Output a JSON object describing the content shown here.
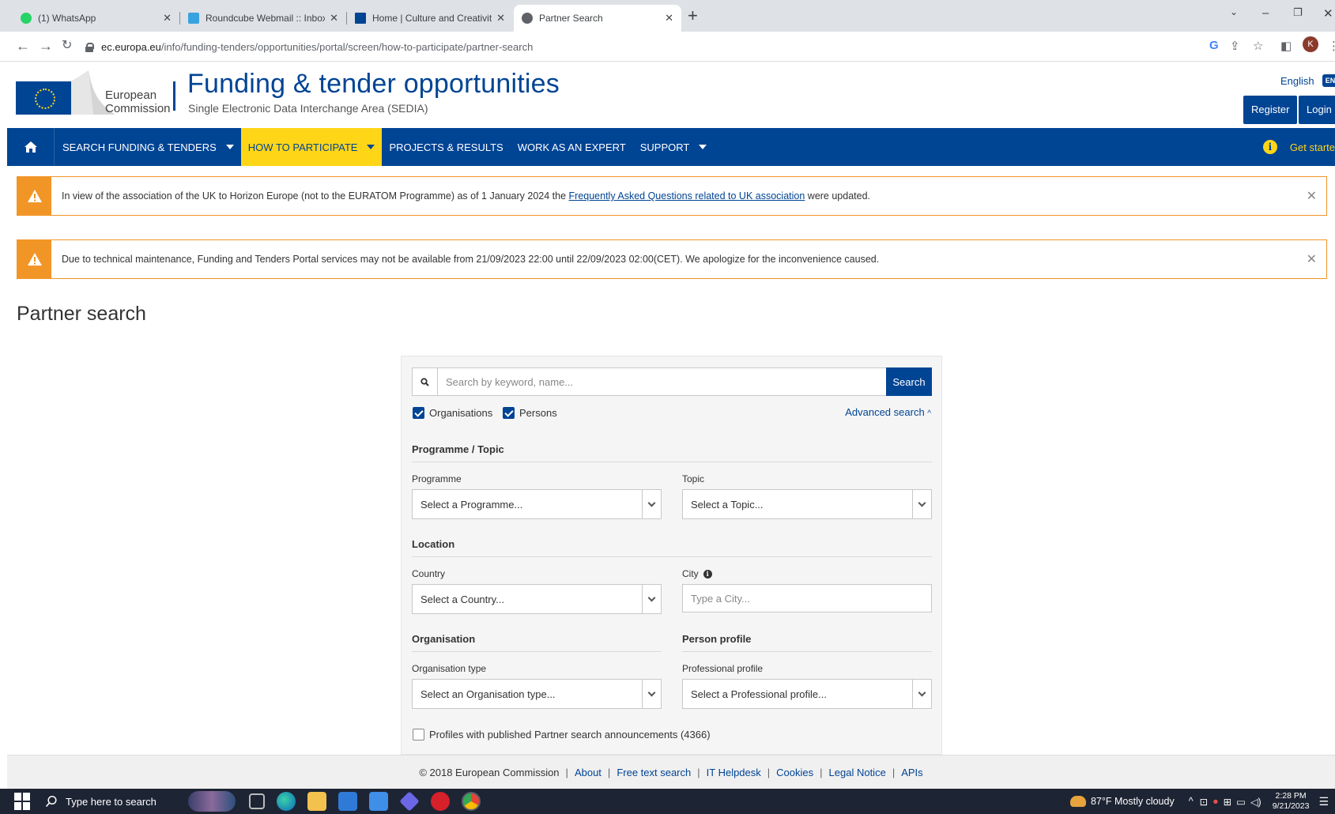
{
  "browser": {
    "tabs": [
      {
        "title": "(1) WhatsApp",
        "icon": "whatsapp-icon",
        "color": "#25d366",
        "active": false
      },
      {
        "title": "Roundcube Webmail :: Inbox",
        "icon": "roundcube-icon",
        "color": "#37a2e0",
        "active": false
      },
      {
        "title": "Home | Culture and Creativity",
        "icon": "eu-flag-icon",
        "color": "#004494",
        "active": false
      },
      {
        "title": "Partner Search",
        "icon": "globe-icon",
        "color": "#5f6368",
        "active": true
      }
    ],
    "url_domain": "ec.europa.eu",
    "url_path": "/info/funding-tenders/opportunities/portal/screen/how-to-participate/partner-search",
    "profile_initial": "K"
  },
  "header": {
    "ec_line1": "European",
    "ec_line2": "Commission",
    "title": "Funding & tender opportunities",
    "subtitle": "Single Electronic Data Interchange Area (SEDIA)",
    "language": "English",
    "language_code": "EN",
    "register": "Register",
    "login": "Login"
  },
  "nav": {
    "items": [
      {
        "label": "SEARCH FUNDING & TENDERS",
        "dropdown": true,
        "active": false
      },
      {
        "label": "HOW TO PARTICIPATE",
        "dropdown": true,
        "active": true
      },
      {
        "label": "PROJECTS & RESULTS",
        "dropdown": false,
        "active": false
      },
      {
        "label": "WORK AS AN EXPERT",
        "dropdown": false,
        "active": false
      },
      {
        "label": "SUPPORT",
        "dropdown": true,
        "active": false
      }
    ],
    "get_started": "Get starte"
  },
  "alerts": [
    {
      "text_before": "In view of the association of the UK to Horizon Europe (not to the EURATOM Programme) as of 1 January 2024 the ",
      "link": "Frequently Asked Questions related to UK association",
      "text_after": " were updated."
    },
    {
      "text_before": "Due to technical maintenance, Funding and Tenders Portal services may not be available from 21/09/2023 22:00 until 22/09/2023 02:00(CET). We apologize for the inconvenience caused.",
      "link": "",
      "text_after": ""
    }
  ],
  "page_title": "Partner search",
  "search": {
    "placeholder": "Search by keyword, name...",
    "button": "Search",
    "organisations": "Organisations",
    "persons": "Persons",
    "advanced": "Advanced search",
    "programme_topic_head": "Programme / Topic",
    "programme_label": "Programme",
    "programme_value": "Select a Programme...",
    "topic_label": "Topic",
    "topic_value": "Select a Topic...",
    "location_head": "Location",
    "country_label": "Country",
    "country_value": "Select a Country...",
    "city_label": "City",
    "city_placeholder": "Type a City...",
    "organisation_head": "Organisation",
    "person_head": "Person profile",
    "org_type_label": "Organisation type",
    "org_type_value": "Select an Organisation type...",
    "prof_label": "Professional profile",
    "prof_value": "Select a Professional profile...",
    "announcements": "Profiles with published Partner search announcements (4366)"
  },
  "footer": {
    "copyright": "© 2018 European Commission",
    "links": [
      "About",
      "Free text search",
      "IT Helpdesk",
      "Cookies",
      "Legal Notice",
      "APIs"
    ]
  },
  "taskbar": {
    "search_placeholder": "Type here to search",
    "weather": "87°F  Mostly cloudy",
    "time": "2:28 PM",
    "date": "9/21/2023"
  },
  "colors": {
    "brand_blue": "#004494",
    "nav_active_yellow": "#ffd617",
    "alert_orange": "#f29527"
  }
}
